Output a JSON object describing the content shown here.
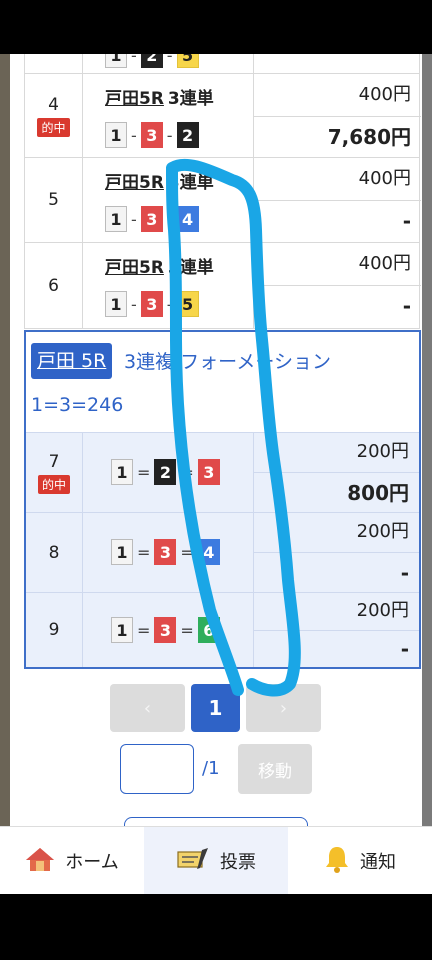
{
  "colors": {
    "accent": "#2f63c7",
    "hit": "#d9392f",
    "drawing": "#1aa6e6"
  },
  "rows_partial": {
    "combo": [
      "1",
      "2",
      "5"
    ]
  },
  "rows": [
    {
      "no": "4",
      "hit": "的中",
      "race": "戸田5R",
      "type": "3連単",
      "combo": [
        "1",
        "3",
        "2"
      ],
      "amount": "400円",
      "payout": "7,680円"
    },
    {
      "no": "5",
      "hit": "",
      "race": "戸田5R",
      "type": "3連単",
      "combo": [
        "1",
        "3",
        "4"
      ],
      "amount": "400円",
      "payout": "-"
    },
    {
      "no": "6",
      "hit": "",
      "race": "戸田5R",
      "type": "3連単",
      "combo": [
        "1",
        "3",
        "5"
      ],
      "amount": "400円",
      "payout": "-"
    }
  ],
  "group": {
    "race": "戸田 5R",
    "type": "3連複 フォーメーション",
    "formula": "1=3=246",
    "rows": [
      {
        "no": "7",
        "hit": "的中",
        "combo": [
          "1",
          "2",
          "3"
        ],
        "amount": "200円",
        "payout": "800円"
      },
      {
        "no": "8",
        "hit": "",
        "combo": [
          "1",
          "3",
          "4"
        ],
        "amount": "200円",
        "payout": "-"
      },
      {
        "no": "9",
        "hit": "",
        "combo": [
          "1",
          "3",
          "6"
        ],
        "amount": "200円",
        "payout": "-"
      }
    ]
  },
  "pager": {
    "prev": "‹",
    "current": "1",
    "next": "›"
  },
  "jump": {
    "value": "",
    "total": "/1",
    "button": "移動"
  },
  "tabs": [
    {
      "label": "ホーム",
      "icon": "home-icon"
    },
    {
      "label": "投票",
      "icon": "ticket-icon"
    },
    {
      "label": "通知",
      "icon": "bell-icon"
    }
  ]
}
